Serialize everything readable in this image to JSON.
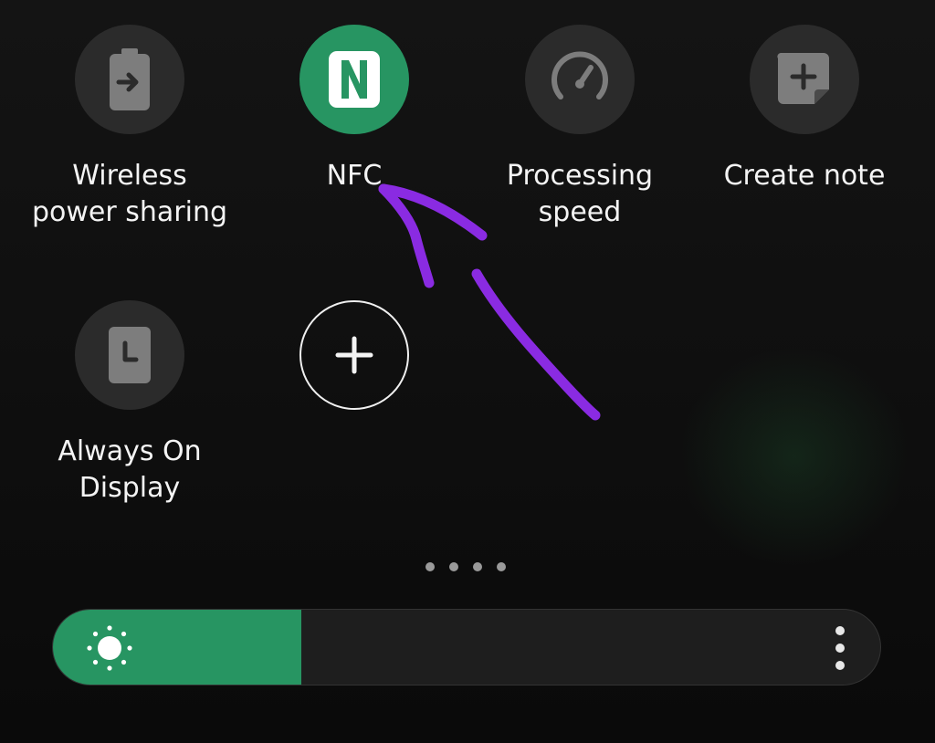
{
  "quick_panel": {
    "tiles": [
      {
        "label": "Wireless\npower sharing",
        "icon": "battery-share-icon",
        "active": false
      },
      {
        "label": "NFC",
        "icon": "nfc-icon",
        "active": true,
        "accent": "#279562"
      },
      {
        "label": "Processing\nspeed",
        "icon": "speedometer-icon",
        "active": false
      },
      {
        "label": "Create note",
        "icon": "note-add-icon",
        "active": false
      },
      {
        "label": "Always On\nDisplay",
        "icon": "clock-display-icon",
        "active": false
      }
    ],
    "add_button_icon": "plus-icon",
    "page_indicator": {
      "pages": 4
    },
    "brightness": {
      "level": 0.3,
      "icon": "sun-icon",
      "menu_icon": "more-vertical-icon",
      "accent": "#279562"
    },
    "annotation": {
      "color": "#8a2be2"
    }
  }
}
